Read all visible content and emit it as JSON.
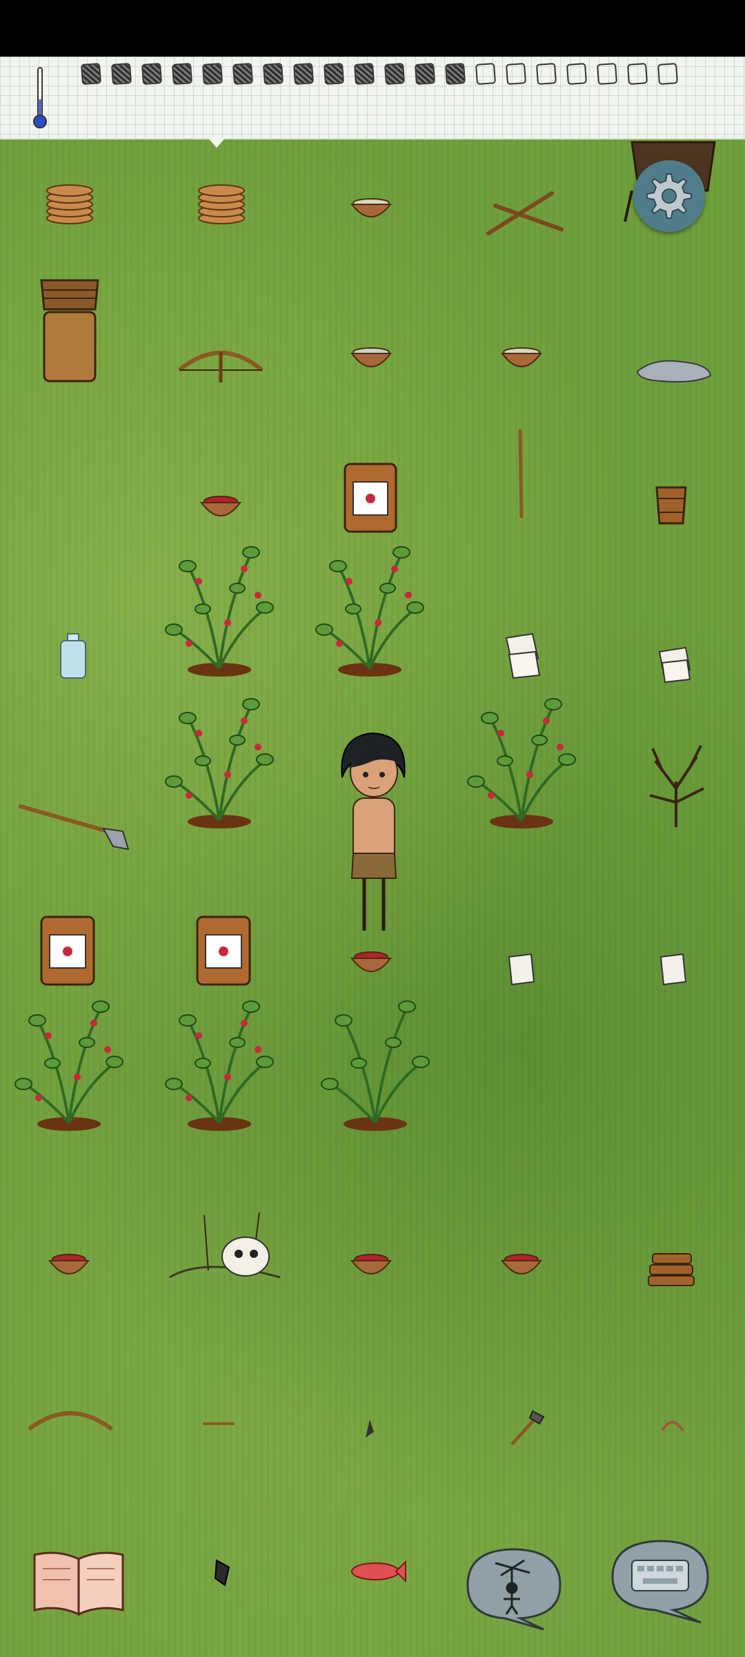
{
  "hud": {
    "food_pips": [
      "full",
      "full",
      "full",
      "full",
      "full",
      "full",
      "full",
      "full",
      "full",
      "full",
      "full",
      "full",
      "full",
      "empty",
      "empty",
      "empty",
      "empty",
      "empty",
      "empty",
      "empty"
    ],
    "temperature_icon": "thermometer-icon"
  },
  "controls": {
    "settings_icon": "gear-icon",
    "book_icon": "tech-book-icon",
    "puppet_icon": "puppet-emote-icon",
    "keyboard_icon": "keyboard-chat-icon"
  },
  "colors": {
    "grass": "#6fa03c",
    "hud_paper": "#f2f4ee",
    "gear_button": "#4f7e8a",
    "bubble": "#8fa1a6"
  }
}
